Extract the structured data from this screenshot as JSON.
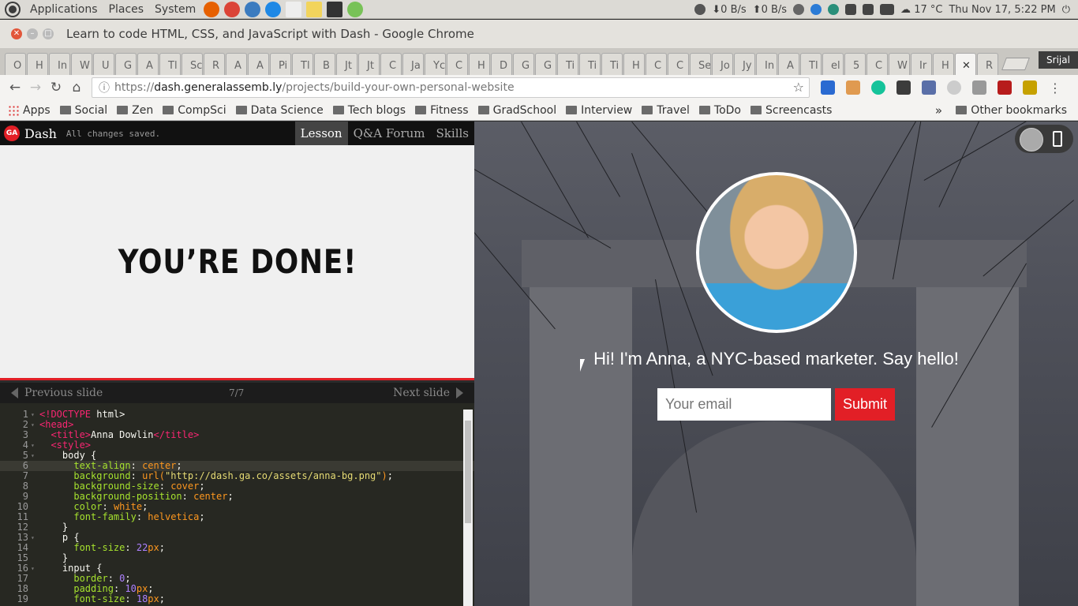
{
  "panel": {
    "menus": [
      "Applications",
      "Places",
      "System"
    ],
    "net_down": "0 B/s",
    "net_up": "0 B/s",
    "temperature": "17 °C",
    "datetime": "Thu Nov 17,  5:22 PM"
  },
  "window": {
    "title": "Learn to code HTML, CSS, and JavaScript with Dash - Google Chrome"
  },
  "tabs": [
    "O",
    "H",
    "In",
    "W",
    "U",
    "G",
    "A",
    "Tl",
    "Sc",
    "R",
    "A",
    "A",
    "Pi",
    "Tl",
    "B",
    "Jt",
    "Jt",
    "C",
    "Ja",
    "Yc",
    "C",
    "H",
    "D",
    "G",
    "G",
    "Ti",
    "Ti",
    "Ti",
    "H",
    "C",
    "C",
    "Se",
    "Jo",
    "Jy",
    "In",
    "A",
    "Tl",
    "el",
    "5",
    "C",
    "W",
    "Ir",
    "H",
    "",
    "R"
  ],
  "profile": "Srijal",
  "address": {
    "scheme": "https://",
    "host": "dash.generalassemb.ly",
    "path": "/projects/build-your-own-personal-website"
  },
  "bookmarks": [
    "Apps",
    "Social",
    "Zen",
    "CompSci",
    "Data Science",
    "Tech blogs",
    "Fitness",
    "GradSchool",
    "Interview",
    "Travel",
    "ToDo",
    "Screencasts"
  ],
  "other_bookmarks": "Other bookmarks",
  "dash": {
    "logo": "GA",
    "name": "Dash",
    "status": "All changes saved.",
    "tabs": [
      "Lesson",
      "Q&A Forum",
      "Skills"
    ],
    "slide_title": "YOU’RE DONE!",
    "prev": "Previous slide",
    "next": "Next slide",
    "position": "7/7"
  },
  "code_lines": [
    {
      "n": "1",
      "f": "▾",
      "c": [
        [
          "t",
          "<!DOCTYPE"
        ],
        [
          "c",
          " html>"
        ]
      ]
    },
    {
      "n": "2",
      "f": "▾",
      "c": [
        [
          "t",
          "<head>"
        ]
      ]
    },
    {
      "n": "3",
      "f": "",
      "c": [
        [
          "c",
          "  "
        ],
        [
          "t",
          "<title>"
        ],
        [
          "c",
          "Anna Dowlin"
        ],
        [
          "t",
          "</title>"
        ]
      ]
    },
    {
      "n": "4",
      "f": "▾",
      "c": [
        [
          "c",
          "  "
        ],
        [
          "t",
          "<style>"
        ]
      ]
    },
    {
      "n": "5",
      "f": "▾",
      "c": [
        [
          "c",
          "    body {"
        ]
      ]
    },
    {
      "n": "6",
      "f": "",
      "c": [
        [
          "c",
          "      "
        ],
        [
          "a",
          "text-align"
        ],
        [
          "c",
          ": "
        ],
        [
          "v",
          "center"
        ],
        [
          "c",
          ";"
        ]
      ]
    },
    {
      "n": "7",
      "f": "",
      "c": [
        [
          "c",
          "      "
        ],
        [
          "a",
          "background"
        ],
        [
          "c",
          ": "
        ],
        [
          "v",
          "url("
        ],
        [
          "s",
          "\"http://dash.ga.co/assets/anna-bg.png\""
        ],
        [
          "v",
          ")"
        ],
        [
          "c",
          ";"
        ]
      ]
    },
    {
      "n": "8",
      "f": "",
      "c": [
        [
          "c",
          "      "
        ],
        [
          "a",
          "background-size"
        ],
        [
          "c",
          ": "
        ],
        [
          "v",
          "cover"
        ],
        [
          "c",
          ";"
        ]
      ]
    },
    {
      "n": "9",
      "f": "",
      "c": [
        [
          "c",
          "      "
        ],
        [
          "a",
          "background-position"
        ],
        [
          "c",
          ": "
        ],
        [
          "v",
          "center"
        ],
        [
          "c",
          ";"
        ]
      ]
    },
    {
      "n": "10",
      "f": "",
      "c": [
        [
          "c",
          "      "
        ],
        [
          "a",
          "color"
        ],
        [
          "c",
          ": "
        ],
        [
          "v",
          "white"
        ],
        [
          "c",
          ";"
        ]
      ]
    },
    {
      "n": "11",
      "f": "",
      "c": [
        [
          "c",
          "      "
        ],
        [
          "a",
          "font-family"
        ],
        [
          "c",
          ": "
        ],
        [
          "v",
          "helvetica"
        ],
        [
          "c",
          ";"
        ]
      ]
    },
    {
      "n": "12",
      "f": "",
      "c": [
        [
          "c",
          "    }"
        ]
      ]
    },
    {
      "n": "13",
      "f": "▾",
      "c": [
        [
          "c",
          "    p {"
        ]
      ]
    },
    {
      "n": "14",
      "f": "",
      "c": [
        [
          "c",
          "      "
        ],
        [
          "a",
          "font-size"
        ],
        [
          "c",
          ": "
        ],
        [
          "p",
          "22"
        ],
        [
          "v",
          "px"
        ],
        [
          "c",
          ";"
        ]
      ]
    },
    {
      "n": "15",
      "f": "",
      "c": [
        [
          "c",
          "    }"
        ]
      ]
    },
    {
      "n": "16",
      "f": "▾",
      "c": [
        [
          "c",
          "    input {"
        ]
      ]
    },
    {
      "n": "17",
      "f": "",
      "c": [
        [
          "c",
          "      "
        ],
        [
          "a",
          "border"
        ],
        [
          "c",
          ": "
        ],
        [
          "p",
          "0"
        ],
        [
          "c",
          ";"
        ]
      ]
    },
    {
      "n": "18",
      "f": "",
      "c": [
        [
          "c",
          "      "
        ],
        [
          "a",
          "padding"
        ],
        [
          "c",
          ": "
        ],
        [
          "p",
          "10"
        ],
        [
          "v",
          "px"
        ],
        [
          "c",
          ";"
        ]
      ]
    },
    {
      "n": "19",
      "f": "",
      "c": [
        [
          "c",
          "      "
        ],
        [
          "a",
          "font-size"
        ],
        [
          "c",
          ": "
        ],
        [
          "p",
          "18"
        ],
        [
          "v",
          "px"
        ],
        [
          "c",
          ";"
        ]
      ]
    }
  ],
  "preview": {
    "greeting": "Hi! I'm Anna, a NYC-based marketer. Say hello!",
    "email_placeholder": "Your email",
    "submit": "Submit"
  }
}
